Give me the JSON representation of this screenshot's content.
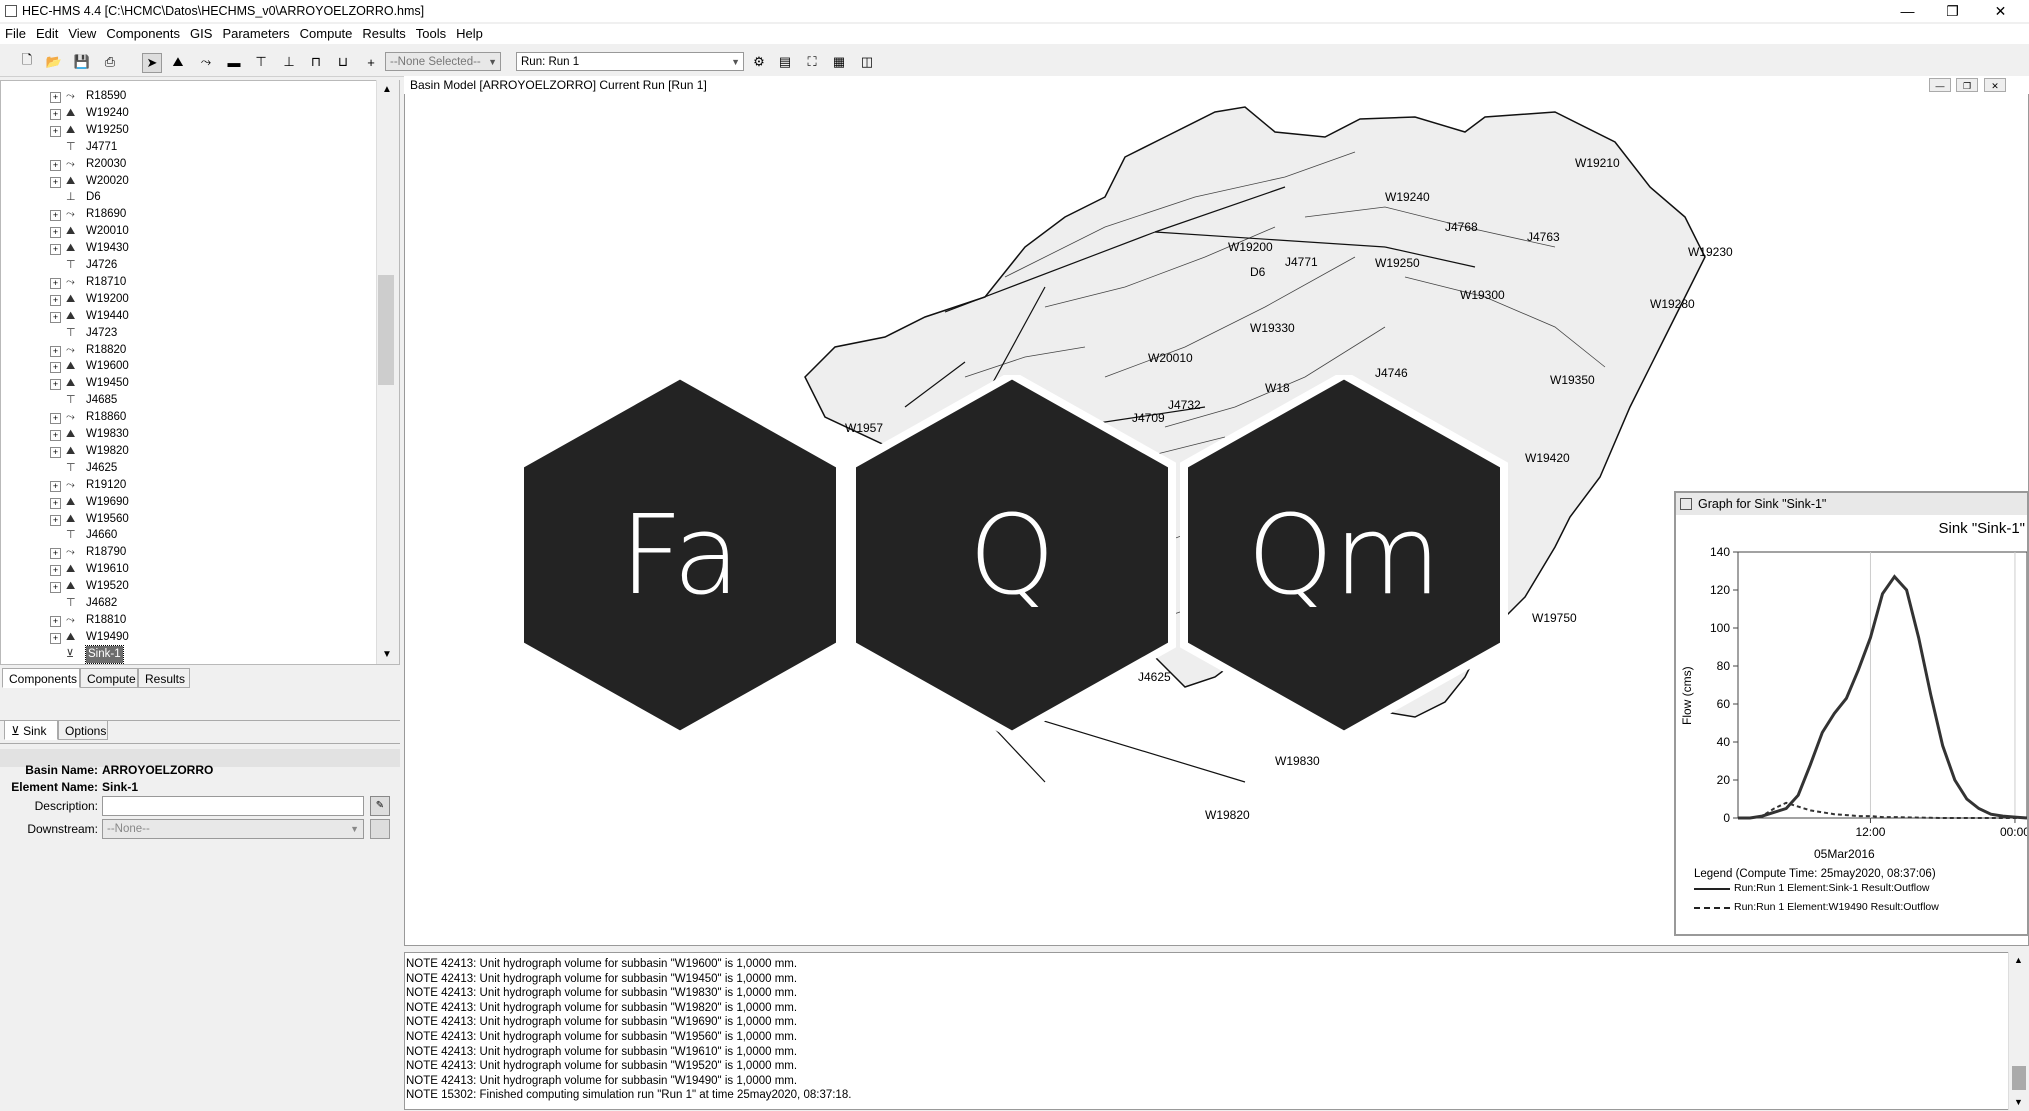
{
  "window": {
    "title": "HEC-HMS 4.4 [C:\\HCMC\\Datos\\HECHMS_v0\\ARROYOELZORRO.hms]",
    "min": "—",
    "max": "❐",
    "close": "✕"
  },
  "menu": [
    "File",
    "Edit",
    "View",
    "Components",
    "GIS",
    "Parameters",
    "Compute",
    "Results",
    "Tools",
    "Help"
  ],
  "toolbar": {
    "selection": "--None Selected--",
    "run": "Run: Run 1"
  },
  "tree": [
    {
      "label": "R18590",
      "type": "reach"
    },
    {
      "label": "W19240",
      "type": "subbasin"
    },
    {
      "label": "W19250",
      "type": "subbasin"
    },
    {
      "label": "J4771",
      "type": "junction"
    },
    {
      "label": "R20030",
      "type": "reach"
    },
    {
      "label": "W20020",
      "type": "subbasin"
    },
    {
      "label": "D6",
      "type": "diversion"
    },
    {
      "label": "R18690",
      "type": "reach"
    },
    {
      "label": "W20010",
      "type": "subbasin"
    },
    {
      "label": "W19430",
      "type": "subbasin"
    },
    {
      "label": "J4726",
      "type": "junction"
    },
    {
      "label": "R18710",
      "type": "reach"
    },
    {
      "label": "W19200",
      "type": "subbasin"
    },
    {
      "label": "W19440",
      "type": "subbasin"
    },
    {
      "label": "J4723",
      "type": "junction"
    },
    {
      "label": "R18820",
      "type": "reach"
    },
    {
      "label": "W19600",
      "type": "subbasin"
    },
    {
      "label": "W19450",
      "type": "subbasin"
    },
    {
      "label": "J4685",
      "type": "junction"
    },
    {
      "label": "R18860",
      "type": "reach"
    },
    {
      "label": "W19830",
      "type": "subbasin"
    },
    {
      "label": "W19820",
      "type": "subbasin"
    },
    {
      "label": "J4625",
      "type": "junction"
    },
    {
      "label": "R19120",
      "type": "reach"
    },
    {
      "label": "W19690",
      "type": "subbasin"
    },
    {
      "label": "W19560",
      "type": "subbasin"
    },
    {
      "label": "J4660",
      "type": "junction"
    },
    {
      "label": "R18790",
      "type": "reach"
    },
    {
      "label": "W19610",
      "type": "subbasin"
    },
    {
      "label": "W19520",
      "type": "subbasin"
    },
    {
      "label": "J4682",
      "type": "junction"
    },
    {
      "label": "R18810",
      "type": "reach"
    },
    {
      "label": "W19490",
      "type": "subbasin"
    },
    {
      "label": "Sink-1",
      "type": "sink",
      "selected": true
    }
  ],
  "panel_tabs": [
    "Components",
    "Compute",
    "Results"
  ],
  "props": {
    "tabs": [
      "Sink",
      "Options"
    ],
    "basin_name_label": "Basin Name:",
    "basin_name": "ARROYOELZORRO",
    "element_name_label": "Element Name:",
    "element_name": "Sink-1",
    "description_label": "Description:",
    "description": "",
    "downstream_label": "Downstream:",
    "downstream": "--None--"
  },
  "basin": {
    "title": "Basin Model [ARROYOELZORRO] Current Run [Run 1]",
    "labels": [
      {
        "text": "W19210"
      },
      {
        "text": "W19240"
      },
      {
        "text": "J4768"
      },
      {
        "text": "J4763"
      },
      {
        "text": "W19230"
      },
      {
        "text": "W19200"
      },
      {
        "text": "D6"
      },
      {
        "text": "J4771"
      },
      {
        "text": "W19250"
      },
      {
        "text": "W19300"
      },
      {
        "text": "W19280"
      },
      {
        "text": "W19330"
      },
      {
        "text": "W20010"
      },
      {
        "text": "J4746"
      },
      {
        "text": "W19350"
      },
      {
        "text": "W18"
      },
      {
        "text": "J4732"
      },
      {
        "text": "J4709"
      },
      {
        "text": "W1957"
      },
      {
        "text": "W19420"
      },
      {
        "text": "W19750"
      },
      {
        "text": "J4625"
      },
      {
        "text": "W19830"
      },
      {
        "text": "W19820"
      }
    ]
  },
  "logo": [
    "Fa",
    "Q",
    "Qm"
  ],
  "graph": {
    "window_title": "Graph for Sink \"Sink-1\"",
    "chart_title": "Sink \"Sink-1\"",
    "ylabel": "Flow (cms)",
    "date_label": "05Mar2016",
    "legend_title": "Legend (Compute Time: 25may2020, 08:37:06)",
    "legend": [
      "Run:Run 1 Element:Sink-1 Result:Outflow",
      "Run:Run 1 Element:W19490 Result:Outflow"
    ]
  },
  "chart_data": {
    "type": "line",
    "title": "Sink \"Sink-1\"",
    "ylabel": "Flow (cms)",
    "ylim": [
      0,
      140
    ],
    "yticks": [
      0,
      20,
      40,
      60,
      80,
      100,
      120,
      140
    ],
    "xticks": [
      "12:00",
      "00:00"
    ],
    "series": [
      {
        "name": "Run:Run 1 Element:Sink-1 Result:Outflow",
        "style": "solid",
        "x": [
          0,
          1,
          2,
          3,
          4,
          5,
          6,
          7,
          8,
          9,
          10,
          11,
          12,
          13,
          14,
          15,
          16,
          17,
          18,
          19,
          20,
          21,
          22,
          23,
          24
        ],
        "values": [
          0,
          0,
          1,
          3,
          5,
          12,
          28,
          45,
          55,
          63,
          78,
          95,
          118,
          127,
          120,
          95,
          65,
          38,
          20,
          10,
          5,
          2,
          1,
          0.5,
          0
        ]
      },
      {
        "name": "Run:Run 1 Element:W19490 Result:Outflow",
        "style": "dashed",
        "x": [
          0,
          1,
          2,
          3,
          4,
          5,
          6,
          7,
          8,
          9,
          10,
          11,
          12,
          13,
          14,
          15,
          16,
          17,
          18,
          19,
          20,
          21,
          22,
          23,
          24
        ],
        "values": [
          0,
          0,
          1,
          5,
          8,
          6,
          4,
          3,
          2,
          1.5,
          1,
          1,
          0.5,
          0.5,
          0.3,
          0.2,
          0.1,
          0,
          0,
          0,
          0,
          0,
          0,
          0,
          0
        ]
      }
    ]
  },
  "messages": [
    "NOTE 42413:  Unit hydrograph volume for subbasin \"W19600\" is 1,0000 mm.",
    "NOTE 42413:  Unit hydrograph volume for subbasin \"W19450\" is 1,0000 mm.",
    "NOTE 42413:  Unit hydrograph volume for subbasin \"W19830\" is 1,0000 mm.",
    "NOTE 42413:  Unit hydrograph volume for subbasin \"W19820\" is 1,0000 mm.",
    "NOTE 42413:  Unit hydrograph volume for subbasin \"W19690\" is 1,0000 mm.",
    "NOTE 42413:  Unit hydrograph volume for subbasin \"W19560\" is 1,0000 mm.",
    "NOTE 42413:  Unit hydrograph volume for subbasin \"W19610\" is 1,0000 mm.",
    "NOTE 42413:  Unit hydrograph volume for subbasin \"W19520\" is 1,0000 mm.",
    "NOTE 42413:  Unit hydrograph volume for subbasin \"W19490\" is 1,0000 mm.",
    "NOTE 15302:  Finished computing simulation run \"Run 1\" at time 25may2020, 08:37:18."
  ]
}
